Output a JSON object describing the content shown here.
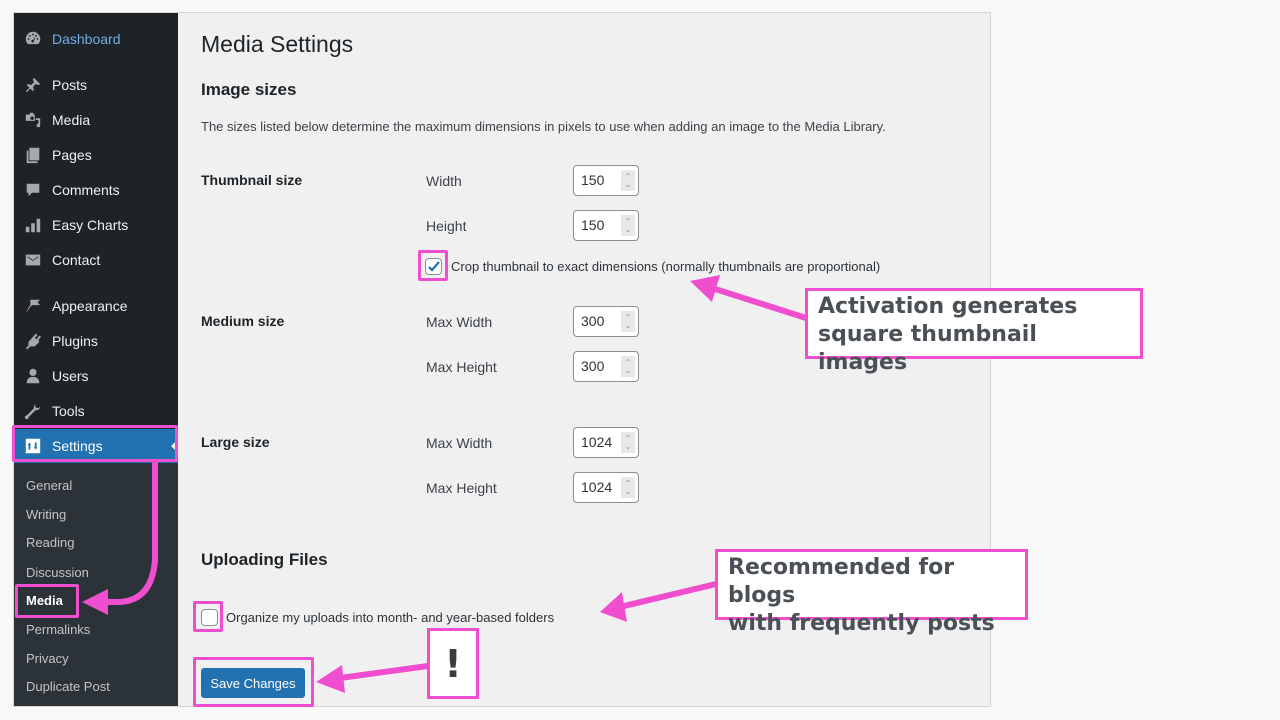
{
  "sidebar": {
    "items": [
      {
        "label": "Dashboard",
        "icon": "dashboard-icon"
      },
      {
        "label": "Posts",
        "icon": "pushpin-icon"
      },
      {
        "label": "Media",
        "icon": "media-icon"
      },
      {
        "label": "Pages",
        "icon": "pages-icon"
      },
      {
        "label": "Comments",
        "icon": "comment-icon"
      },
      {
        "label": "Easy Charts",
        "icon": "bar-chart-icon"
      },
      {
        "label": "Contact",
        "icon": "envelope-icon"
      },
      {
        "label": "Appearance",
        "icon": "paintbrush-icon"
      },
      {
        "label": "Plugins",
        "icon": "plug-icon"
      },
      {
        "label": "Users",
        "icon": "user-icon"
      },
      {
        "label": "Tools",
        "icon": "wrench-icon"
      },
      {
        "label": "Settings",
        "icon": "settings-icon",
        "active": true
      }
    ],
    "submenu": [
      {
        "label": "General"
      },
      {
        "label": "Writing"
      },
      {
        "label": "Reading"
      },
      {
        "label": "Discussion"
      },
      {
        "label": "Media",
        "current": true
      },
      {
        "label": "Permalinks"
      },
      {
        "label": "Privacy"
      },
      {
        "label": "Duplicate Post"
      }
    ]
  },
  "page": {
    "title": "Media Settings",
    "image_sizes": {
      "heading": "Image sizes",
      "description": "The sizes listed below determine the maximum dimensions in pixels to use when adding an image to the Media Library.",
      "thumbnail": {
        "label": "Thumbnail size",
        "width_label": "Width",
        "width": "150",
        "height_label": "Height",
        "height": "150",
        "crop_label": "Crop thumbnail to exact dimensions (normally thumbnails are proportional)",
        "crop_checked": true
      },
      "medium": {
        "label": "Medium size",
        "width_label": "Max Width",
        "width": "300",
        "height_label": "Max Height",
        "height": "300"
      },
      "large": {
        "label": "Large size",
        "width_label": "Max Width",
        "width": "1024",
        "height_label": "Max Height",
        "height": "1024"
      }
    },
    "uploading": {
      "heading": "Uploading Files",
      "organize_label": "Organize my uploads into month- and year-based folders",
      "organize_checked": false
    },
    "save_label": "Save Changes"
  },
  "annotations": {
    "crop_note": [
      "Activation generates",
      "square thumbnail images"
    ],
    "organize_note": [
      "Recommended for blogs",
      "with frequently posts"
    ],
    "save_note": "!",
    "highlight_color": "#ef4fcf"
  },
  "colors": {
    "sidebar_bg": "#1d2327",
    "submenu_bg": "#2c3338",
    "accent": "#2271b1",
    "dashboard_link": "#72aee6"
  }
}
